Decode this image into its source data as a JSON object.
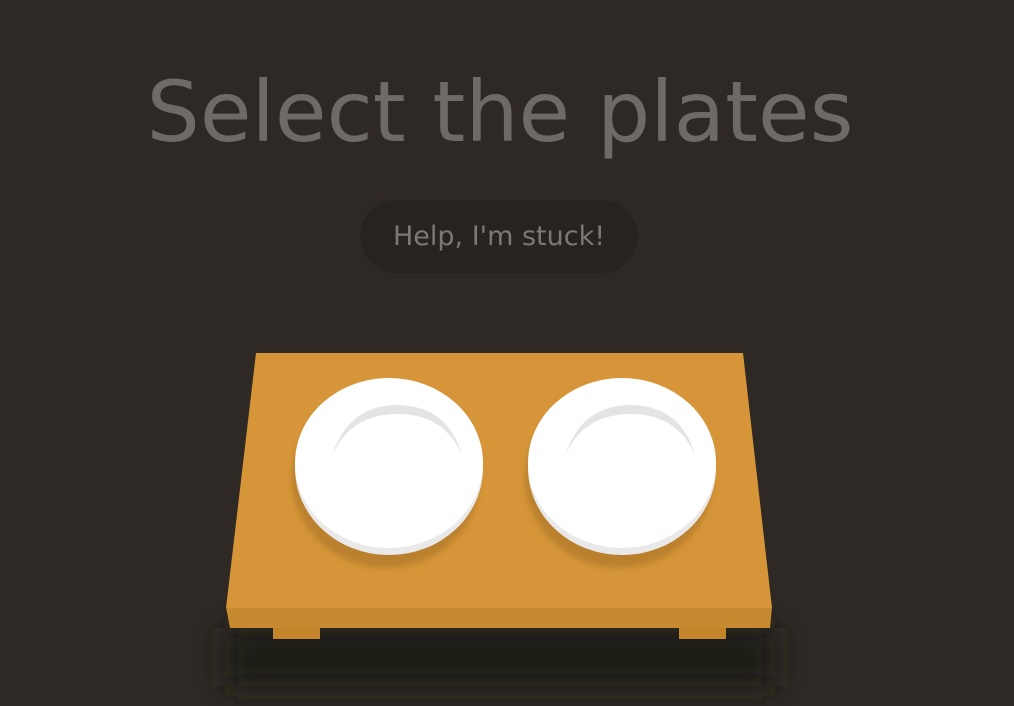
{
  "game": {
    "title": "Select the plates",
    "help_label": "Help, I'm stuck!"
  },
  "table": {
    "top_color": "#d89a3c",
    "front_color": "#c98a2e",
    "leg_color": "#b97a25",
    "plates": [
      {
        "name": "left-plate"
      },
      {
        "name": "right-plate"
      }
    ]
  },
  "colors": {
    "background": "#2e2924",
    "plate": "#ffffff",
    "plate_rim": "#e6e6e6",
    "title": "#6e6a66"
  }
}
